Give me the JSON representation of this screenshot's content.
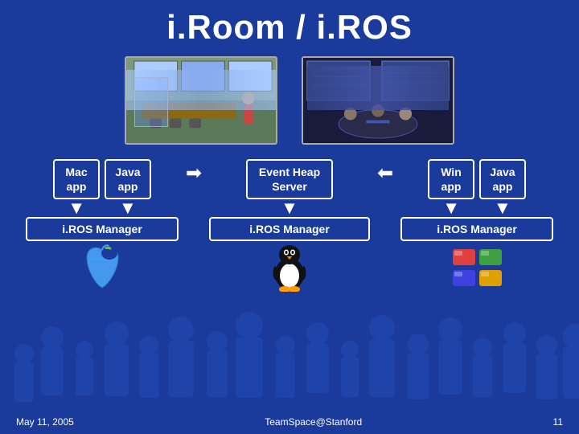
{
  "title": "i.Room / i.ROS",
  "photos": [
    {
      "id": "photo-left",
      "alt": "Conference room with large screens and person"
    },
    {
      "id": "photo-right",
      "alt": "Dark conference room with screens and people"
    }
  ],
  "diagram": {
    "left_col": {
      "boxes": [
        "Mac app",
        "Java app"
      ],
      "manager": "i.ROS Manager",
      "logo_alt": "Apple logo"
    },
    "center_col": {
      "box": "Event Heap Server",
      "manager": "i.ROS Manager",
      "logo_alt": "Linux Tux penguin"
    },
    "right_col": {
      "boxes": [
        "Win app",
        "Java app"
      ],
      "manager": "i.ROS Manager",
      "logo_alt": "Windows logo"
    }
  },
  "footer": {
    "date": "May 11, 2005",
    "credit": "TeamSpace@Stanford",
    "page": "11"
  },
  "arrows": {
    "right": "➤",
    "left": "➤",
    "down": "▼"
  }
}
